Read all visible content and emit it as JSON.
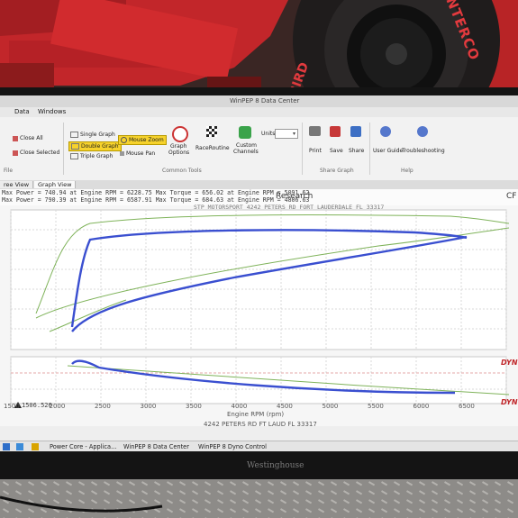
{
  "photo": {
    "tire_brand": "INTERCO",
    "tire_model": "BIRD",
    "monitor_brand": "Westinghouse"
  },
  "app": {
    "title": "WinPEP 8 Data Center",
    "menu": {
      "data": "Data",
      "windows": "Windows"
    },
    "ribbon": {
      "close_all": "Close All",
      "close_selected": "Close Selected",
      "file_group": "File",
      "single_graph": "Single Graph",
      "double_graph": "Double Graph",
      "triple_graph": "Triple Graph",
      "mouse_zoom": "Mouse Zoom",
      "mouse_pan": "Mouse Pan",
      "graph_options_1": "Graph",
      "graph_options_2": "Options",
      "raceroutine": "RaceRoutine",
      "custom_channels_1": "Custom",
      "custom_channels_2": "Channels",
      "units": "Units",
      "common_tools": "Common Tools",
      "print": "Print",
      "save": "Save",
      "share": "Share",
      "share_graph": "Share Graph",
      "user_guide": "User Guide",
      "troubleshooting": "Troubleshooting",
      "help": "Help"
    },
    "tabs": {
      "tree_view": "ree View",
      "graph_view": "Graph View"
    },
    "legend": [
      "Max Power = 740.94 at Engine RPM = 6228.75   Max Torque = 656.02 at Engine RPM = 5091.62",
      "Max Power = 790.39 at Engine RPM = 6587.91   Max Torque = 684.63 at Engine RPM = 4806.63"
    ],
    "research": "Research",
    "cf": "CF",
    "header_info": "STP MOTORSPORT 4242 PETERS RD FORT LAUDERDALE FL 33317",
    "dyno_mark": "DYN",
    "lower_value": "1506.526",
    "x_ticks": [
      "1500",
      "2000",
      "2500",
      "3000",
      "3500",
      "4000",
      "4500",
      "5000",
      "5500",
      "6000",
      "6500"
    ],
    "x_label": "Engine RPM (rpm)",
    "footer": "4242 PETERS RD FT LAUD FL 33317"
  },
  "taskbar": {
    "items": [
      "Power Core - Applica...",
      "WinPEP 8 Data Center",
      "WinPEP 8 Dyno Control"
    ]
  },
  "colors": {
    "power_run_1": "#3a4fd0",
    "power_run_2": "#7fb35a"
  }
}
